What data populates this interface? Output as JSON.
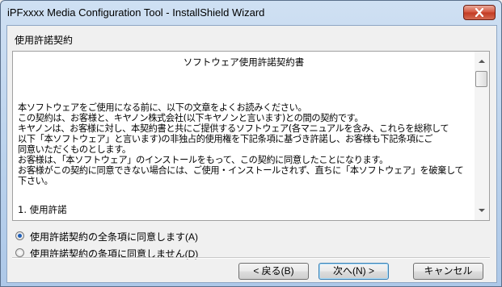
{
  "window": {
    "title": "iPFxxxx Media Configuration Tool - InstallShield Wizard",
    "close_icon": "close-icon"
  },
  "page": {
    "heading": "使用許諾契約"
  },
  "license": {
    "title": "ソフトウェア使用許諾契約書",
    "lines": [
      "本ソフトウェアをご使用になる前に、以下の文章をよくお読みください。",
      "この契約は、お客様と、キヤノン株式会社(以下キヤノンと言います)との間の契約です。",
      "キヤノンは、お客様に対し、本契約書と共にご提供するソフトウェア(各マニュアルを含み、これらを総称して",
      "以下「本ソフトウェア」と言います)の非独占的使用権を下記条項に基づき許諾し、お客様も下記条項にご",
      "同意いただくものとします。",
      "お客様は、「本ソフトウェア」のインストールをもって、この契約に同意したことになります。",
      "お客様がこの契約に同意できない場合には、ご使用・インストールされず、直ちに「本ソフトウェア」を破棄して",
      "下さい。"
    ],
    "section_1": "1. 使用許諾"
  },
  "options": {
    "accept_label": "使用許諾契約の全条項に同意します(A)",
    "decline_label": "使用許諾契約の条項に同意しません(D)",
    "selected": "accept"
  },
  "buttons": {
    "back": "< 戻る(B)",
    "next": "次へ(N) >",
    "cancel": "キャンセル"
  }
}
